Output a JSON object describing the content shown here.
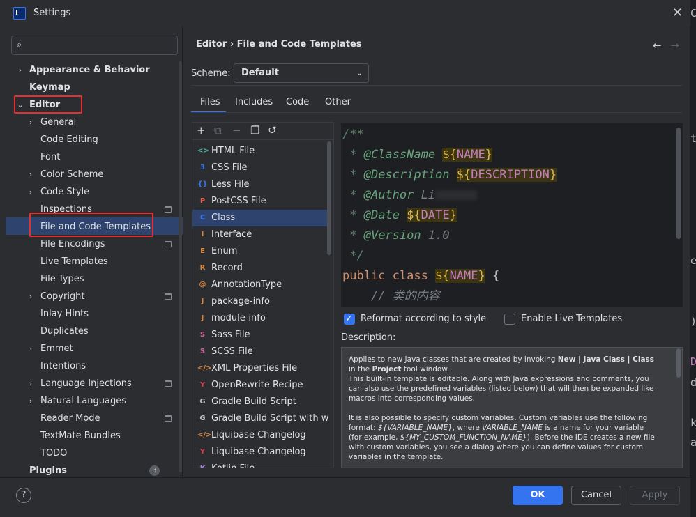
{
  "window": {
    "title": "Settings"
  },
  "search": {
    "placeholder": ""
  },
  "sidebar": {
    "items": [
      {
        "label": "Appearance & Behavior",
        "level": 0,
        "bold": true,
        "chevron": "right"
      },
      {
        "label": "Keymap",
        "level": 0,
        "bold": true
      },
      {
        "label": "Editor",
        "level": 0,
        "bold": true,
        "chevron": "down"
      },
      {
        "label": "General",
        "level": 1,
        "chevron": "right"
      },
      {
        "label": "Code Editing",
        "level": 1
      },
      {
        "label": "Font",
        "level": 1
      },
      {
        "label": "Color Scheme",
        "level": 1,
        "chevron": "right"
      },
      {
        "label": "Code Style",
        "level": 1,
        "chevron": "right"
      },
      {
        "label": "Inspections",
        "level": 1,
        "badge": true
      },
      {
        "label": "File and Code Templates",
        "level": 1,
        "selected": true
      },
      {
        "label": "File Encodings",
        "level": 1,
        "badge": true
      },
      {
        "label": "Live Templates",
        "level": 1
      },
      {
        "label": "File Types",
        "level": 1
      },
      {
        "label": "Copyright",
        "level": 1,
        "chevron": "right",
        "badge": true
      },
      {
        "label": "Inlay Hints",
        "level": 1
      },
      {
        "label": "Duplicates",
        "level": 1
      },
      {
        "label": "Emmet",
        "level": 1,
        "chevron": "right"
      },
      {
        "label": "Intentions",
        "level": 1
      },
      {
        "label": "Language Injections",
        "level": 1,
        "chevron": "right",
        "badge": true
      },
      {
        "label": "Natural Languages",
        "level": 1,
        "chevron": "right"
      },
      {
        "label": "Reader Mode",
        "level": 1,
        "badge": true
      },
      {
        "label": "TextMate Bundles",
        "level": 1
      },
      {
        "label": "TODO",
        "level": 1
      },
      {
        "label": "Plugins",
        "level": 0,
        "bold": true,
        "count": "3"
      }
    ]
  },
  "breadcrumb": {
    "text": "Editor  ›  File and Code Templates"
  },
  "scheme": {
    "label": "Scheme:",
    "value": "Default"
  },
  "tabs": [
    "Files",
    "Includes",
    "Code",
    "Other"
  ],
  "templates": [
    {
      "label": "HTML File",
      "icon": "html-icon",
      "color": "#4db6ac",
      "glyph": "<>"
    },
    {
      "label": "CSS File",
      "icon": "css-icon",
      "color": "#3574f0",
      "glyph": "3"
    },
    {
      "label": "Less File",
      "icon": "less-icon",
      "color": "#3574f0",
      "glyph": "{}"
    },
    {
      "label": "PostCSS File",
      "icon": "postcss-icon",
      "color": "#e55b4d",
      "glyph": "P"
    },
    {
      "label": "Class",
      "icon": "class-icon",
      "color": "#3574f0",
      "glyph": "C"
    },
    {
      "label": "Interface",
      "icon": "interface-icon",
      "color": "#e0883b",
      "glyph": "I"
    },
    {
      "label": "Enum",
      "icon": "enum-icon",
      "color": "#e0883b",
      "glyph": "E"
    },
    {
      "label": "Record",
      "icon": "record-icon",
      "color": "#e0883b",
      "glyph": "R"
    },
    {
      "label": "AnnotationType",
      "icon": "annotation-icon",
      "color": "#e0883b",
      "glyph": "@"
    },
    {
      "label": "package-info",
      "icon": "java-file-icon",
      "color": "#e0883b",
      "glyph": "J"
    },
    {
      "label": "module-info",
      "icon": "java-file-icon",
      "color": "#e0883b",
      "glyph": "J"
    },
    {
      "label": "Sass File",
      "icon": "sass-icon",
      "color": "#cf649a",
      "glyph": "S"
    },
    {
      "label": "SCSS File",
      "icon": "scss-icon",
      "color": "#cf649a",
      "glyph": "S"
    },
    {
      "label": "XML Properties File",
      "icon": "xml-icon",
      "color": "#e0883b",
      "glyph": "</>"
    },
    {
      "label": "OpenRewrite Recipe",
      "icon": "openrewrite-icon",
      "color": "#db3b4b",
      "glyph": "Y"
    },
    {
      "label": "Gradle Build Script",
      "icon": "gradle-icon",
      "color": "#bcbec4",
      "glyph": "G"
    },
    {
      "label": "Gradle Build Script with wrapp",
      "icon": "gradle-icon",
      "color": "#bcbec4",
      "glyph": "G"
    },
    {
      "label": "Liquibase Changelog",
      "icon": "liquibase-icon",
      "color": "#e0883b",
      "glyph": "</>"
    },
    {
      "label": "Liquibase Changelog",
      "icon": "liquibase-icon",
      "color": "#db3b4b",
      "glyph": "Y"
    },
    {
      "label": "Kotlin File",
      "icon": "kotlin-icon",
      "color": "#a97bff",
      "glyph": "K"
    }
  ],
  "selected_template": "Class",
  "code": {
    "line1": "/**",
    "line2_prefix": " * ",
    "line2_tag": "@ClassName",
    "line2_var": "NAME",
    "line3_prefix": " * ",
    "line3_tag": "@Description",
    "line3_var": "DESCRIPTION",
    "line4_prefix": " * ",
    "line4_tag": "@Author",
    "line4_value": "Li",
    "line5_prefix": " * ",
    "line5_tag": "@Date",
    "line5_var": "DATE",
    "line6_prefix": " * ",
    "line6_tag": "@Version",
    "line6_value": "1.0",
    "line7": " */",
    "line8_kw": "public class",
    "line8_var": "NAME",
    "line8_end": "{",
    "line9": "    // 类的内容"
  },
  "options": {
    "reformat": {
      "label": "Reformat according to style",
      "checked": true
    },
    "live_templates": {
      "label": "Enable Live Templates",
      "checked": false
    }
  },
  "description": {
    "label": "Description:",
    "p1_a": "Applies to new Java classes that are created by invoking ",
    "p1_b": "New | Java Class | Class",
    "p1_c": " in the ",
    "p1_d": "Project",
    "p1_e": " tool window.",
    "p1_f": "This built-in template is editable. Along with Java expressions and comments, you can also use the predefined variables (listed below) that will then be expanded like macros into corresponding values.",
    "p2_a": "It is also possible to specify custom variables. Custom variables use the following format: ",
    "p2_b": "${VARIABLE_NAME}",
    "p2_c": ", where ",
    "p2_d": "VARIABLE_NAME",
    "p2_e": " is a name for your variable (for example, ",
    "p2_f": "${MY_CUSTOM_FUNCTION_NAME}",
    "p2_g": "). Before the IDE creates a new file with custom variables, you see a dialog where you can define values for custom variables in the template."
  },
  "buttons": {
    "help": "?",
    "ok": "OK",
    "cancel": "Cancel",
    "apply": "Apply"
  },
  "colors": {
    "accent": "#3574f0",
    "selection": "#2e436e",
    "highlight_box": "#e5302f"
  }
}
